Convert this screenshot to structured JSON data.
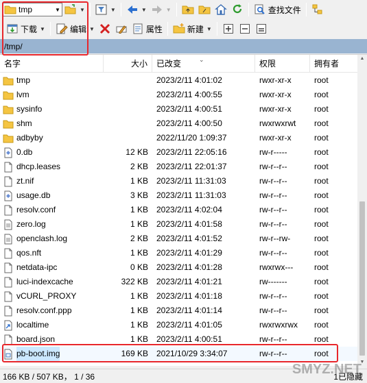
{
  "toolbar1": {
    "location_combo": "tmp"
  },
  "toolbar2": {
    "download_label": "下载",
    "edit_label": "编辑",
    "properties_label": "属性",
    "new_label": "新建"
  },
  "find_files_label": "查找文件",
  "path": "/tmp/",
  "columns": {
    "name": "名字",
    "size": "大小",
    "modified": "已改变",
    "permissions": "权限",
    "owner": "拥有者"
  },
  "files": [
    {
      "name": "tmp",
      "size": "",
      "modified": "2023/2/11 4:01:02",
      "permissions": "rwxr-xr-x",
      "owner": "root",
      "icon": "folder-icon"
    },
    {
      "name": "lvm",
      "size": "",
      "modified": "2023/2/11 4:00:55",
      "permissions": "rwxr-xr-x",
      "owner": "root",
      "icon": "folder-icon"
    },
    {
      "name": "sysinfo",
      "size": "",
      "modified": "2023/2/11 4:00:51",
      "permissions": "rwxr-xr-x",
      "owner": "root",
      "icon": "folder-icon"
    },
    {
      "name": "shm",
      "size": "",
      "modified": "2023/2/11 4:00:50",
      "permissions": "rwxrwxrwt",
      "owner": "root",
      "icon": "folder-icon"
    },
    {
      "name": "adbyby",
      "size": "",
      "modified": "2022/11/20 1:09:37",
      "permissions": "rwxr-xr-x",
      "owner": "root",
      "icon": "folder-icon"
    },
    {
      "name": "0.db",
      "size": "12 KB",
      "modified": "2023/2/11 22:05:16",
      "permissions": "rw-r-----",
      "owner": "root",
      "icon": "db-file-icon"
    },
    {
      "name": "dhcp.leases",
      "size": "2 KB",
      "modified": "2023/2/11 22:01:37",
      "permissions": "rw-r--r--",
      "owner": "root",
      "icon": "file-icon"
    },
    {
      "name": "zt.nif",
      "size": "1 KB",
      "modified": "2023/2/11 11:31:03",
      "permissions": "rw-r--r--",
      "owner": "root",
      "icon": "file-icon"
    },
    {
      "name": "usage.db",
      "size": "3 KB",
      "modified": "2023/2/11 11:31:03",
      "permissions": "rw-r--r--",
      "owner": "root",
      "icon": "db-file-icon"
    },
    {
      "name": "resolv.conf",
      "size": "1 KB",
      "modified": "2023/2/11 4:02:04",
      "permissions": "rw-r--r--",
      "owner": "root",
      "icon": "file-icon"
    },
    {
      "name": "zero.log",
      "size": "1 KB",
      "modified": "2023/2/11 4:01:58",
      "permissions": "rw-r--r--",
      "owner": "root",
      "icon": "text-file-icon"
    },
    {
      "name": "openclash.log",
      "size": "2 KB",
      "modified": "2023/2/11 4:01:52",
      "permissions": "rw-r--rw-",
      "owner": "root",
      "icon": "text-file-icon"
    },
    {
      "name": "qos.nft",
      "size": "1 KB",
      "modified": "2023/2/11 4:01:29",
      "permissions": "rw-r--r--",
      "owner": "root",
      "icon": "file-icon"
    },
    {
      "name": "netdata-ipc",
      "size": "0 KB",
      "modified": "2023/2/11 4:01:28",
      "permissions": "rwxrwx---",
      "owner": "root",
      "icon": "file-icon"
    },
    {
      "name": "luci-indexcache",
      "size": "322 KB",
      "modified": "2023/2/11 4:01:21",
      "permissions": "rw-------",
      "owner": "root",
      "icon": "file-icon"
    },
    {
      "name": "vCURL_PROXY",
      "size": "1 KB",
      "modified": "2023/2/11 4:01:18",
      "permissions": "rw-r--r--",
      "owner": "root",
      "icon": "file-icon"
    },
    {
      "name": "resolv.conf.ppp",
      "size": "1 KB",
      "modified": "2023/2/11 4:01:14",
      "permissions": "rw-r--r--",
      "owner": "root",
      "icon": "file-icon"
    },
    {
      "name": "localtime",
      "size": "1 KB",
      "modified": "2023/2/11 4:01:05",
      "permissions": "rwxrwxrwx",
      "owner": "root",
      "icon": "link-file-icon"
    },
    {
      "name": "board.json",
      "size": "1 KB",
      "modified": "2023/2/11 4:00:51",
      "permissions": "rw-r--r--",
      "owner": "root",
      "icon": "file-icon"
    },
    {
      "name": "pb-boot.img",
      "size": "169 KB",
      "modified": "2021/10/29 3:34:07",
      "permissions": "rw-r--r--",
      "owner": "root",
      "icon": "image-file-icon",
      "selected": true
    }
  ],
  "status": {
    "left": "166 KB / 507 KB，  1 / 36",
    "right": "1已隐藏"
  },
  "watermark": "SMYZ.NET",
  "colors": {
    "path_bar": "#99b4d1",
    "selection": "#cce8ff",
    "highlight_box": "#e8262b",
    "folder": "#f5c542"
  }
}
